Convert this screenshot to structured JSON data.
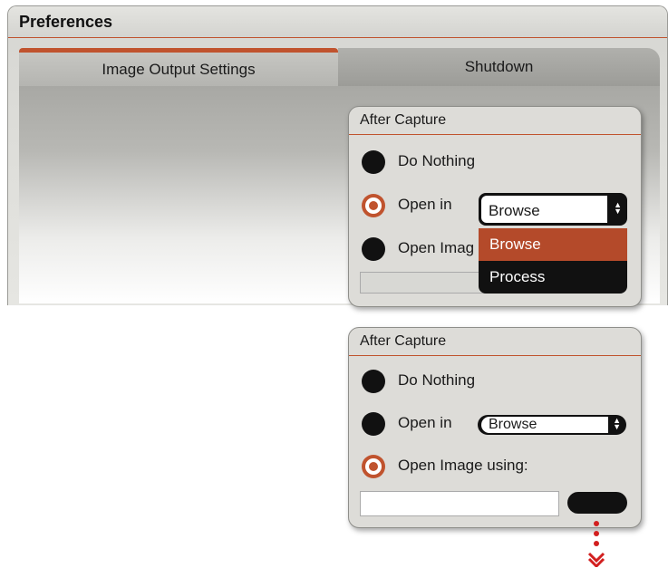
{
  "window": {
    "title": "Preferences"
  },
  "tabs": [
    {
      "label": "Image Output Settings",
      "active": true
    },
    {
      "label": "Shutdown",
      "active": false
    }
  ],
  "state_expanded": {
    "group_title": "After Capture",
    "options": [
      "Do Nothing",
      "Open in",
      "Open Imag"
    ],
    "selected_option": "Open in",
    "select_value": "Browse",
    "dropdown_options": [
      "Browse",
      "Process"
    ],
    "highlighted_option": "Browse"
  },
  "state_collapsed": {
    "group_title": "After Capture",
    "options": [
      "Do Nothing",
      "Open in",
      "Open Image using:"
    ],
    "selected_option": "Open Image using:",
    "select_value": "Browse",
    "text_value": ""
  },
  "colors": {
    "accent": "#c0532e",
    "highlight": "#b44a2a",
    "indicator": "#d21f1f"
  },
  "icons": {
    "select_arrows": "up-down-arrows-icon",
    "indicator": "chevron-down-icon"
  }
}
